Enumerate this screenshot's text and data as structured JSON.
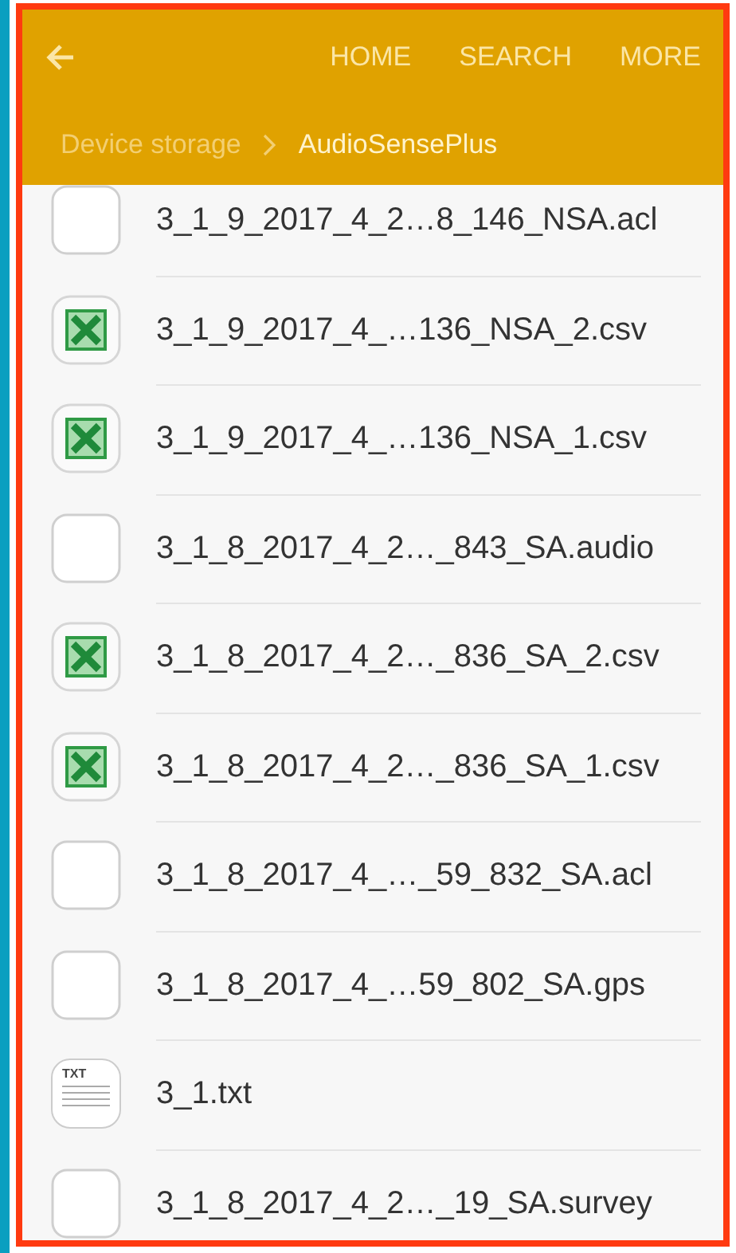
{
  "toolbar": {
    "actions": [
      "HOME",
      "SEARCH",
      "MORE"
    ]
  },
  "breadcrumb": [
    {
      "label": "Device storage",
      "selected": false
    },
    {
      "label": "AudioSensePlus",
      "selected": true
    }
  ],
  "files": [
    {
      "name": "3_1_9_2017_4_2…8_146_NSA.acl",
      "kind": "blank"
    },
    {
      "name": "3_1_9_2017_4_…136_NSA_2.csv",
      "kind": "excel"
    },
    {
      "name": "3_1_9_2017_4_…136_NSA_1.csv",
      "kind": "excel"
    },
    {
      "name": "3_1_8_2017_4_2…_843_SA.audio",
      "kind": "blank"
    },
    {
      "name": "3_1_8_2017_4_2…_836_SA_2.csv",
      "kind": "excel"
    },
    {
      "name": "3_1_8_2017_4_2…_836_SA_1.csv",
      "kind": "excel"
    },
    {
      "name": "3_1_8_2017_4_…_59_832_SA.acl",
      "kind": "blank"
    },
    {
      "name": "3_1_8_2017_4_…59_802_SA.gps",
      "kind": "blank"
    },
    {
      "name": "3_1.txt",
      "kind": "txt",
      "icon_label": "TXT"
    },
    {
      "name": "3_1_8_2017_4_2…_19_SA.survey",
      "kind": "blank"
    }
  ]
}
